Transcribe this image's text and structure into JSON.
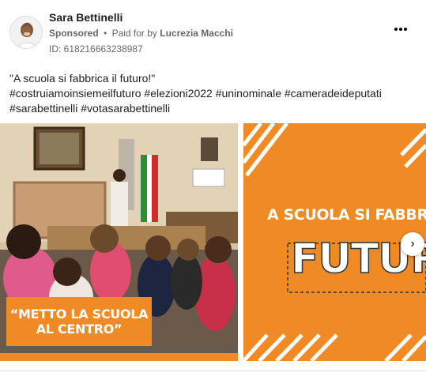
{
  "post": {
    "author_name": "Sara Bettinelli",
    "sponsored_label": "Sponsored",
    "dot": "•",
    "paid_for_label": "Paid for by",
    "payer": "Lucrezia Macchi",
    "ad_id_text": "ID: 618216663238987",
    "body_lines": [
      "\"A scuola si fabbrica il futuro!\"",
      "#costruiamoinsiemeilfuturo #elezioni2022 #uninominale #cameradeideputati",
      "#sarabettinelli #votasarabettinelli"
    ]
  },
  "carousel": {
    "slide1_caption_line1": "“METTO LA SCUOLA",
    "slide1_caption_line2": "AL CENTRO”",
    "slide2_line1": "A SCUOLA SI FABBRICA",
    "slide2_word": "FUTURO",
    "next_glyph": "›"
  },
  "icons": {
    "more": "more-horizontal-icon",
    "next": "chevron-right-icon"
  },
  "colors": {
    "accent_orange": "#f08a24",
    "text_primary": "#1c1e21",
    "text_secondary": "#65676b"
  }
}
